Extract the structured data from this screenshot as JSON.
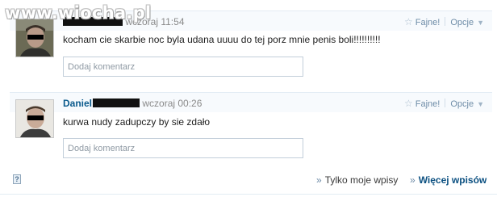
{
  "watermark": "www.wiocha.pl",
  "posts": [
    {
      "author": "",
      "timestamp": "wczoraj 11:54",
      "text": "kocham cie skarbie noc byla udana uuuu do tej porz mnie penis boli!!!!!!!!!!",
      "fajne_label": "Fajne!",
      "opcje_label": "Opcje",
      "comment_placeholder": "Dodaj komentarz"
    },
    {
      "author": "Daniel",
      "timestamp": "wczoraj 00:26",
      "text": "kurwa nudy zadupczy by sie zdało",
      "fajne_label": "Fajne!",
      "opcje_label": "Opcje",
      "comment_placeholder": "Dodaj komentarz"
    }
  ],
  "footer": {
    "own_posts_label": "Tylko moje wpisy",
    "more_posts_label": "Więcej wpisów",
    "help_glyph": "?"
  },
  "colors": {
    "link_blue": "#0a5a8c",
    "header_bg": "#f7fafd",
    "border": "#c3cfda"
  }
}
